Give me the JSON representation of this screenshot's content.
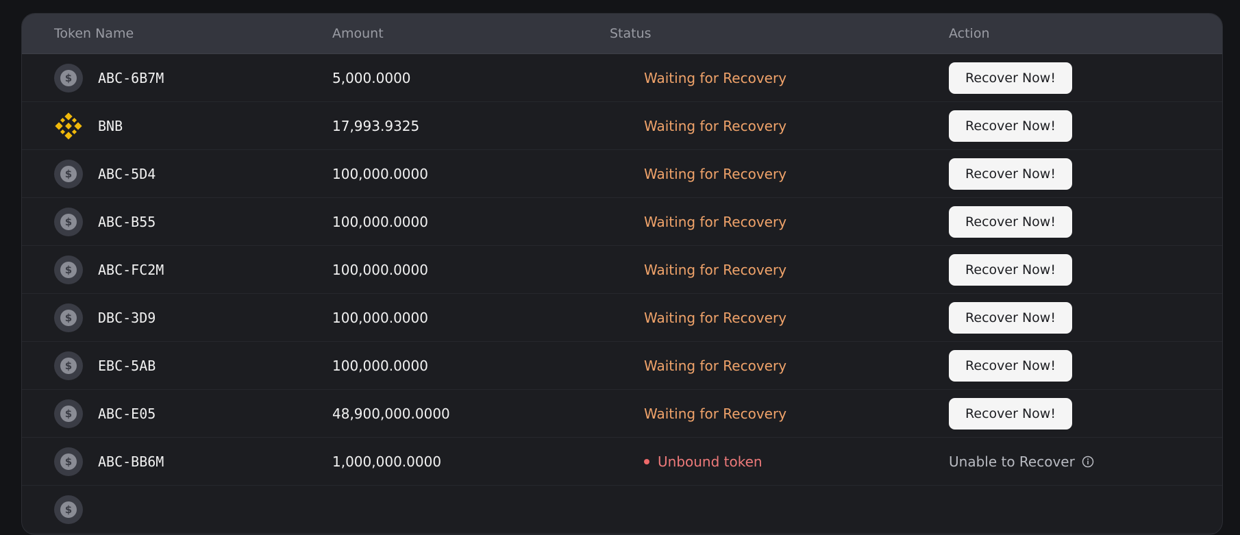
{
  "table": {
    "headers": {
      "token_name": "Token Name",
      "amount": "Amount",
      "status": "Status",
      "action": "Action"
    },
    "rows": [
      {
        "icon": "dollar-coin-icon",
        "name": "ABC-6B7M",
        "amount": "5,000.0000",
        "status": "Waiting for Recovery",
        "action": "Recover Now!"
      },
      {
        "icon": "bnb-icon",
        "name": "BNB",
        "amount": "17,993.9325",
        "status": "Waiting for Recovery",
        "action": "Recover Now!"
      },
      {
        "icon": "dollar-coin-icon",
        "name": "ABC-5D4",
        "amount": "100,000.0000",
        "status": "Waiting for Recovery",
        "action": "Recover Now!"
      },
      {
        "icon": "dollar-coin-icon",
        "name": "ABC-B55",
        "amount": "100,000.0000",
        "status": "Waiting for Recovery",
        "action": "Recover Now!"
      },
      {
        "icon": "dollar-coin-icon",
        "name": "ABC-FC2M",
        "amount": "100,000.0000",
        "status": "Waiting for Recovery",
        "action": "Recover Now!"
      },
      {
        "icon": "dollar-coin-icon",
        "name": "DBC-3D9",
        "amount": "100,000.0000",
        "status": "Waiting for Recovery",
        "action": "Recover Now!"
      },
      {
        "icon": "dollar-coin-icon",
        "name": "EBC-5AB",
        "amount": "100,000.0000",
        "status": "Waiting for Recovery",
        "action": "Recover Now!"
      },
      {
        "icon": "dollar-coin-icon",
        "name": "ABC-E05",
        "amount": "48,900,000.0000",
        "status": "Waiting for Recovery",
        "action": "Recover Now!"
      },
      {
        "icon": "dollar-coin-icon",
        "name": "ABC-BB6M",
        "amount": "1,000,000.0000",
        "status": "Unbound token",
        "action": "Unable to Recover"
      }
    ]
  },
  "colors": {
    "status_waiting": "#f0a36a",
    "status_unbound": "#ee7a7a",
    "bnb_yellow": "#f0b90b"
  }
}
